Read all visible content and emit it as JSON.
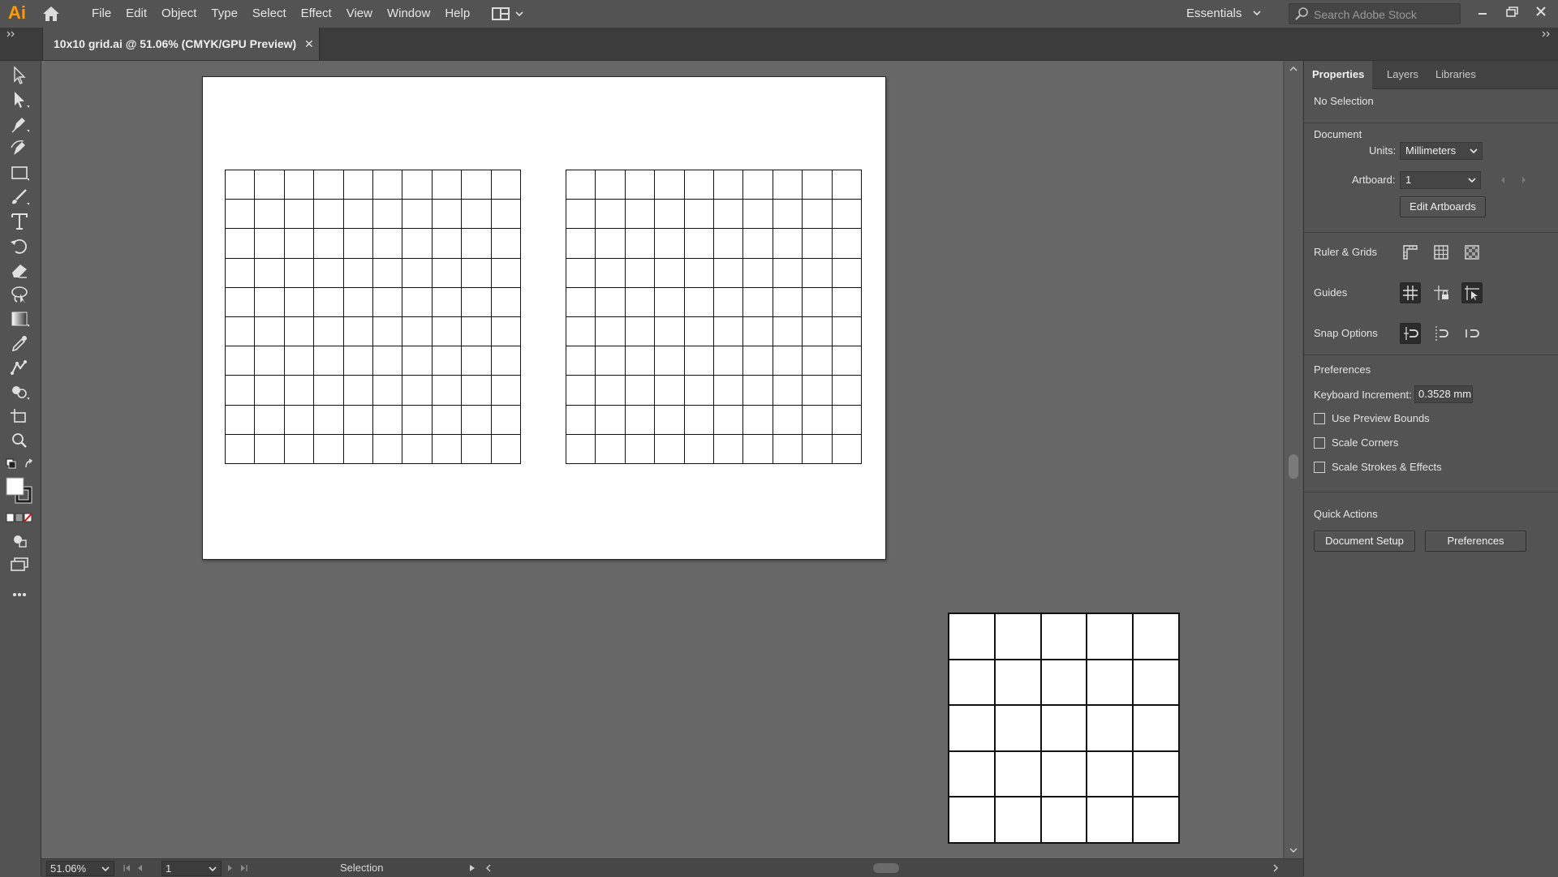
{
  "app": {
    "logo_text": "Ai",
    "menus": [
      "File",
      "Edit",
      "Object",
      "Type",
      "Select",
      "Effect",
      "View",
      "Window",
      "Help"
    ],
    "workspace": "Essentials",
    "search_placeholder": "Search Adobe Stock",
    "accent_color": "#ff9a00"
  },
  "document": {
    "tab_title": "10x10 grid.ai @ 51.06% (CMYK/GPU Preview)",
    "close_glyph": "✕"
  },
  "statusbar": {
    "zoom": "51.06%",
    "artboard_number": "1",
    "current_tool": "Selection"
  },
  "panel": {
    "tabs": [
      "Properties",
      "Layers",
      "Libraries"
    ],
    "active_tab": "Properties",
    "selection_state": "No Selection",
    "document_section": "Document",
    "units_label": "Units:",
    "units_value": "Millimeters",
    "artboard_label": "Artboard:",
    "artboard_value": "1",
    "edit_artboards": "Edit Artboards",
    "ruler_grids_label": "Ruler & Grids",
    "guides_label": "Guides",
    "snap_label": "Snap Options",
    "preferences_section": "Preferences",
    "keyboard_increment_label": "Keyboard Increment:",
    "keyboard_increment_value": "0.3528 mm",
    "checkboxes": [
      {
        "label": "Use Preview Bounds",
        "checked": false
      },
      {
        "label": "Scale Corners",
        "checked": false
      },
      {
        "label": "Scale Strokes & Effects",
        "checked": false
      }
    ],
    "quick_actions_section": "Quick Actions",
    "document_setup": "Document Setup",
    "preferences_button": "Preferences"
  },
  "canvas": {
    "grids": [
      {
        "rows": 10,
        "cols": 10
      },
      {
        "rows": 10,
        "cols": 10
      },
      {
        "rows": 5,
        "cols": 5
      }
    ]
  }
}
